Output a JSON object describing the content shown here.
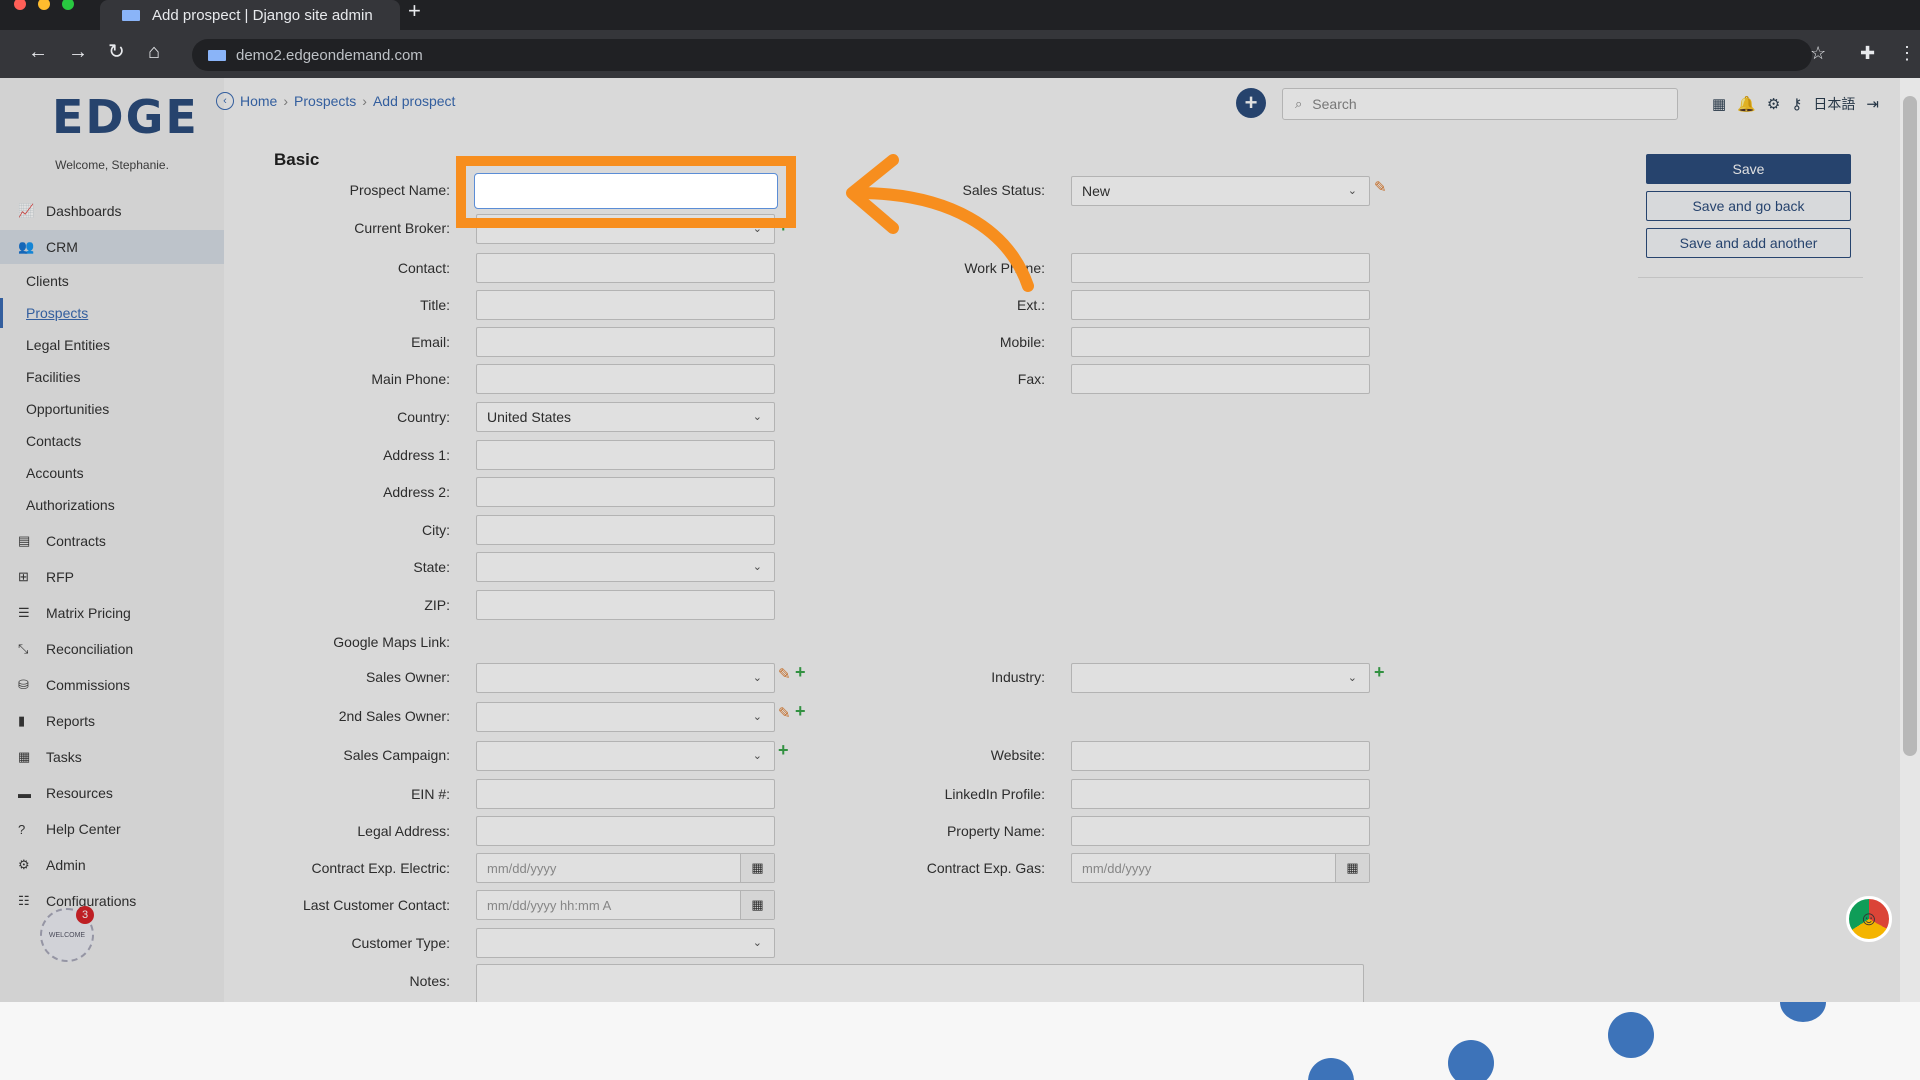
{
  "browser": {
    "tab_title": "Add prospect | Django site admin",
    "url": "demo2.edgeondemand.com"
  },
  "app": {
    "logo": "EDGE",
    "welcome": "Welcome, Stephanie."
  },
  "breadcrumb": {
    "home": "Home",
    "prospects": "Prospects",
    "current": "Add prospect"
  },
  "search": {
    "placeholder": "Search"
  },
  "topbar": {
    "language": "日本語"
  },
  "sidebar": {
    "items": [
      {
        "label": "Dashboards",
        "icon": "chart-line-icon"
      },
      {
        "label": "CRM",
        "icon": "users-icon"
      },
      {
        "label": "Contracts",
        "icon": "file-icon"
      },
      {
        "label": "RFP",
        "icon": "sitemap-icon"
      },
      {
        "label": "Matrix Pricing",
        "icon": "list-icon"
      },
      {
        "label": "Reconciliation",
        "icon": "compress-icon"
      },
      {
        "label": "Commissions",
        "icon": "coins-icon"
      },
      {
        "label": "Reports",
        "icon": "bar-chart-icon"
      },
      {
        "label": "Tasks",
        "icon": "calendar-check-icon"
      },
      {
        "label": "Resources",
        "icon": "folder-icon"
      },
      {
        "label": "Help Center",
        "icon": "question-icon"
      },
      {
        "label": "Admin",
        "icon": "cogs-icon"
      },
      {
        "label": "Configurations",
        "icon": "sliders-icon"
      }
    ],
    "crm_sub": [
      "Clients",
      "Prospects",
      "Legal Entities",
      "Facilities",
      "Opportunities",
      "Contacts",
      "Accounts",
      "Authorizations"
    ],
    "badge_count": "3"
  },
  "form": {
    "section": "Basic",
    "labels": {
      "prospect_name": "Prospect Name:",
      "current_broker": "Current Broker:",
      "contact": "Contact:",
      "title": "Title:",
      "email": "Email:",
      "main_phone": "Main Phone:",
      "country": "Country:",
      "address1": "Address 1:",
      "address2": "Address 2:",
      "city": "City:",
      "state": "State:",
      "zip": "ZIP:",
      "google_maps": "Google Maps Link:",
      "sales_owner": "Sales Owner:",
      "second_sales_owner": "2nd Sales Owner:",
      "sales_campaign": "Sales Campaign:",
      "ein": "EIN #:",
      "legal_address": "Legal Address:",
      "contract_exp_electric": "Contract Exp. Electric:",
      "last_customer_contact": "Last Customer Contact:",
      "customer_type": "Customer Type:",
      "notes": "Notes:",
      "sales_status": "Sales Status:",
      "work_phone": "Work Phone:",
      "ext": "Ext.:",
      "mobile": "Mobile:",
      "fax": "Fax:",
      "industry": "Industry:",
      "website": "Website:",
      "linkedin": "LinkedIn Profile:",
      "property_name": "Property Name:",
      "contract_exp_gas": "Contract Exp. Gas:"
    },
    "values": {
      "country": "United States",
      "sales_status": "New"
    },
    "placeholders": {
      "date": "mm/dd/yyyy",
      "datetime": "mm/dd/yyyy hh:mm A"
    }
  },
  "actions": {
    "save": "Save",
    "save_back": "Save and go back",
    "save_another": "Save and add another"
  },
  "colors": {
    "brand": "#2c4d7d",
    "highlight": "#f78e1e",
    "add_green": "#3aa54a",
    "edit_orange": "#e07a2a"
  }
}
